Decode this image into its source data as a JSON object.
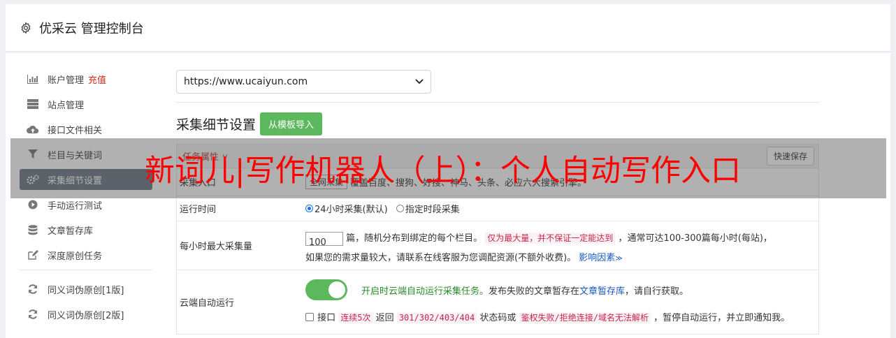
{
  "header": {
    "title": "优采云 管理控制台",
    "icon": "gear-icon"
  },
  "sidebar": {
    "items": [
      {
        "label": "账户管理",
        "extra": "充值",
        "icon": "bar-chart-icon"
      },
      {
        "label": "站点管理",
        "icon": "server-icon"
      },
      {
        "label": "接口文件相关",
        "icon": "cloud-upload-icon"
      },
      {
        "label": "栏目与关键词",
        "icon": "filter-icon"
      },
      {
        "label": "采集细节设置",
        "icon": "cogs-icon",
        "active": true
      },
      {
        "label": "手动运行测试",
        "icon": "play-icon"
      },
      {
        "label": "文章暂存库",
        "icon": "database-icon"
      },
      {
        "label": "深度原创任务",
        "icon": "edit-icon"
      }
    ],
    "items2": [
      {
        "label": "同义词伪原创[1版]",
        "icon": "refresh-icon"
      },
      {
        "label": "同义词伪原创[2版]",
        "icon": "refresh-icon"
      }
    ]
  },
  "main": {
    "site_select": "https://www.ucaiyun.com",
    "section_title": "采集细节设置",
    "import_button": "从模板导入",
    "task_attr_label": "任务属性 ∨",
    "quick_save": "快速保存",
    "rows": {
      "source": {
        "key": "采集入口",
        "mode": "全网采集",
        "desc": "覆盖百度、搜狗、好搜、神马、头条、必应六大搜索引擎。"
      },
      "runtime": {
        "key": "运行时间",
        "opt1": "24小时采集(默认)",
        "opt2": "指定时段采集"
      },
      "max": {
        "key": "每小时最大采集量",
        "value": "100",
        "t1": "篇，随机分布到绑定的每个栏目。",
        "code": "仅为最大量，并不保证一定能达到",
        "t2": "，通常可达100-300篇每小时(每站)，",
        "t3": "如果您的需求量较大，请联系在线客服为您调配资源(不额外收费)。",
        "link": "影响因素"
      },
      "cloud": {
        "key": "云端自动运行",
        "t1": "开启时云端自动运行采集任务。",
        "t2": "发布失败的文章暂存在",
        "link": "文章暂存库",
        "t3": "，请自行获取。",
        "c1": "接口",
        "code1": "连续5次",
        "c2": "返回",
        "code2": "301/302/403/404",
        "c3": "状态码或",
        "code3": "鉴权失败/拒绝连接/域名无法解析",
        "c4": "，暂停自动运行，并立即通知我。"
      }
    }
  },
  "overlay": {
    "text": "新词儿|写作机器人（上）：个人自动写作入口"
  }
}
